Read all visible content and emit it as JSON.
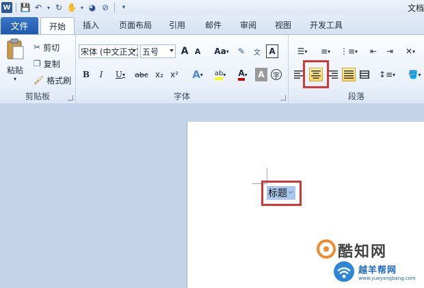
{
  "window": {
    "title": "文档"
  },
  "ribbon_tabs": [
    {
      "label": "文件"
    },
    {
      "label": "开始"
    },
    {
      "label": "插入"
    },
    {
      "label": "页面布局"
    },
    {
      "label": "引用"
    },
    {
      "label": "邮件"
    },
    {
      "label": "审阅"
    },
    {
      "label": "视图"
    },
    {
      "label": "开发工具"
    }
  ],
  "clipboard": {
    "paste": "粘贴",
    "cut": "剪切",
    "copy": "复制",
    "format_painter": "格式刷",
    "group": "剪贴板"
  },
  "font": {
    "name": "宋体 (中文正文)",
    "size": "五号",
    "group": "字体",
    "bold": "B",
    "italic": "I",
    "underline": "U",
    "strike": "abc",
    "sub": "x₂",
    "sup": "x²",
    "aa": "Aa",
    "grow": "A",
    "shrink": "A"
  },
  "paragraph": {
    "group": "段落"
  },
  "document": {
    "text": "标题"
  },
  "watermark": {
    "line1": "酷知网",
    "line2": "越羊帮网",
    "url": "www.yueyangbang.com"
  },
  "colors": {
    "highlight_border": "#d63535",
    "font_color": "#c00000",
    "highlight": "#ffff00"
  }
}
